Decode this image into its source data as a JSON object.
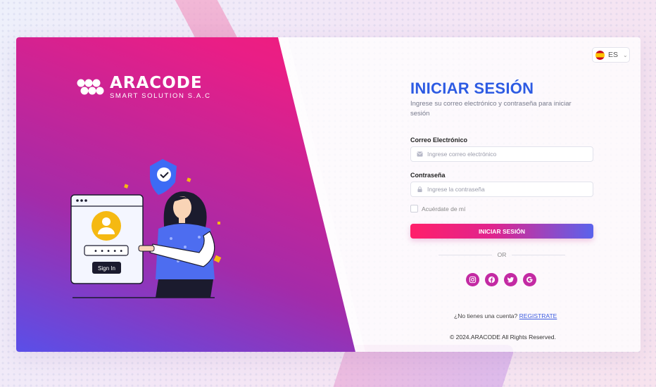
{
  "brand": {
    "name": "ARACODE",
    "tagline": "SMART SOLUTION S.A.C"
  },
  "illustration": {
    "button_label": "Sign In",
    "password_mask": "• • • • •"
  },
  "language": {
    "code": "ES",
    "flag_icon": "spain-flag-icon"
  },
  "login": {
    "title": "INICIAR SESIÓN",
    "subtitle": "Ingrese su correo electrónico y contraseña para iniciar sesión",
    "email_label": "Correo Electrónico",
    "email_placeholder": "Ingrese correo electrónico",
    "email_value": "",
    "password_label": "Contraseña",
    "password_placeholder": "Ingrese la contraseña",
    "password_value": "",
    "remember_label": "Acuérdate de mí",
    "submit_label": "INICIAR SESIÓN",
    "or_label": "OR"
  },
  "social": [
    {
      "name": "instagram-icon"
    },
    {
      "name": "facebook-icon"
    },
    {
      "name": "twitter-icon"
    },
    {
      "name": "google-icon"
    }
  ],
  "signup": {
    "prompt": "¿No tienes una cuenta?",
    "link": "REGISTRATE"
  },
  "footer": {
    "text": "© 2024.ARACODE All Rights Reserved."
  },
  "colors": {
    "primary": "#2d5be3",
    "accent_pink": "#ff1f6a",
    "accent_purple": "#5a63ec",
    "social": "#c32aa3"
  }
}
